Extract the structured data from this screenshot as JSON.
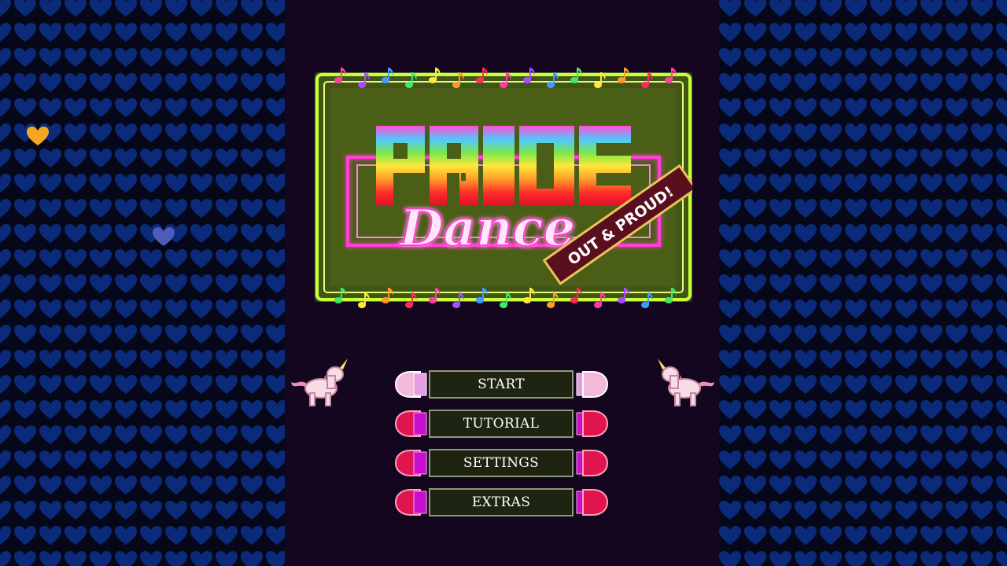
{
  "game": {
    "logo_word1": "PRIDE",
    "logo_word2": "Dance",
    "logo_ribbon": "OUT & PROUD!"
  },
  "menu": {
    "items": [
      {
        "id": "start",
        "label": "START",
        "selected": true
      },
      {
        "id": "tutorial",
        "label": "TUTORIAL",
        "selected": false
      },
      {
        "id": "settings",
        "label": "SETTINGS",
        "selected": false
      },
      {
        "id": "extras",
        "label": "EXTRAS",
        "selected": false
      }
    ]
  },
  "colors": {
    "wall_background": "#06081a",
    "heart": "#0b2a7a",
    "heart_highlight_orange": "#f5a623",
    "heart_highlight_blue": "#4c5cb8",
    "panel": "#14061f",
    "frame_neon": "#c8ff3a",
    "frame_fill": "#445a12",
    "neon_pink": "#ff3fd1",
    "button_selected_end": "#f4b8d8",
    "button_normal_end": "#e0144e",
    "button_bar": "#1e2412"
  },
  "icons": {
    "decor": [
      "heart-icon",
      "music-note-icon",
      "unicorn-icon"
    ]
  }
}
